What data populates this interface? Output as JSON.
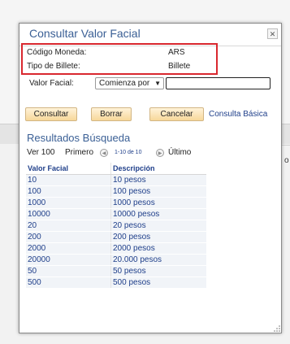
{
  "background": {
    "edge_text": "o"
  },
  "modal": {
    "title": "Consultar Valor Facial",
    "close_icon": "close-icon",
    "info": {
      "currency_label": "Código Moneda:",
      "currency_value": "ARS",
      "type_label": "Tipo de Billete:",
      "type_value": "Billete"
    },
    "search": {
      "field_label": "Valor Facial:",
      "operator_value": "Comienza por",
      "input_value": ""
    },
    "buttons": {
      "consultar": "Consultar",
      "borrar": "Borrar",
      "cancelar": "Cancelar",
      "basic_link": "Consulta Básica"
    },
    "results": {
      "title": "Resultados Búsqueda",
      "nav": {
        "view_all": "Ver 100",
        "first": "Primero",
        "prev_icon": "chevron-left-icon",
        "range": "1-10 de 10",
        "next_icon": "chevron-right-icon",
        "last": "Último"
      },
      "columns": [
        "Valor Facial",
        "Descripción"
      ],
      "rows": [
        [
          "10",
          "10 pesos"
        ],
        [
          "100",
          "100 pesos"
        ],
        [
          "1000",
          "1000 pesos"
        ],
        [
          "10000",
          "10000 pesos"
        ],
        [
          "20",
          "20 pesos"
        ],
        [
          "200",
          "200 pesos"
        ],
        [
          "2000",
          "2000 pesos"
        ],
        [
          "20000",
          "20.000 pesos"
        ],
        [
          "50",
          "50 pesos"
        ],
        [
          "500",
          "500 pesos"
        ]
      ]
    }
  },
  "colors": {
    "accent_blue": "#3a5f95",
    "link_blue": "#1f3f8a",
    "highlight_red": "#d9282f",
    "button_fill": "#f7d79a"
  }
}
